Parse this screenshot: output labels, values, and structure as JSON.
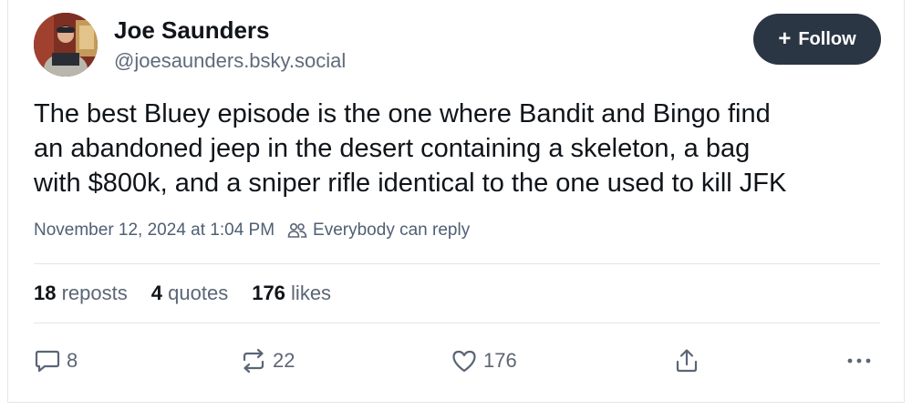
{
  "author": {
    "name": "Joe Saunders",
    "handle": "@joesaunders.bsky.social",
    "follow_label": "Follow"
  },
  "post": {
    "lines": [
      "The best Bluey episode is the one where Bandit and Bingo find",
      "an abandoned jeep in the desert containing a skeleton, a bag",
      "with $800k, and a sniper rifle identical to the one used to kill JFK"
    ],
    "timestamp": "November 12, 2024 at 1:04 PM",
    "reply_setting": "Everybody can reply"
  },
  "stats": {
    "reposts_count": "18",
    "reposts_label": "reposts",
    "quotes_count": "4",
    "quotes_label": "quotes",
    "likes_count": "176",
    "likes_label": "likes"
  },
  "actions": {
    "reply_count": "8",
    "repost_count": "22",
    "like_count": "176",
    "share_icon": "share-icon",
    "more_icon": "more-icon"
  },
  "colors": {
    "follow_bg": "#2b3644",
    "muted_text": "#5b6675",
    "text": "#0f1419"
  }
}
